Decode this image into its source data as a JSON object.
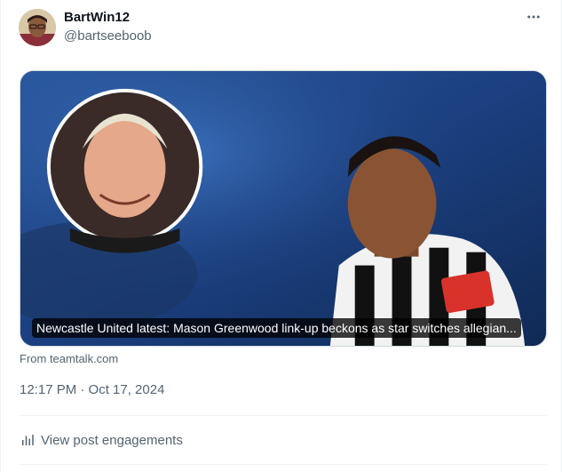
{
  "author": {
    "name": "BartWin12",
    "handle": "@bartseeboob"
  },
  "icons": {
    "more": "more-horizontal-icon",
    "engagements": "bar-chart-icon"
  },
  "card": {
    "caption": "Newcastle United latest: Mason Greenwood link-up beckons as star switches allegian...",
    "source": "From teamtalk.com"
  },
  "meta": {
    "timestamp": "12:17 PM · Oct 17, 2024"
  },
  "actions": {
    "engagements_label": "View post engagements"
  },
  "colors": {
    "text_primary": "#0f1419",
    "text_secondary": "#536471",
    "border": "#eff3f4"
  }
}
